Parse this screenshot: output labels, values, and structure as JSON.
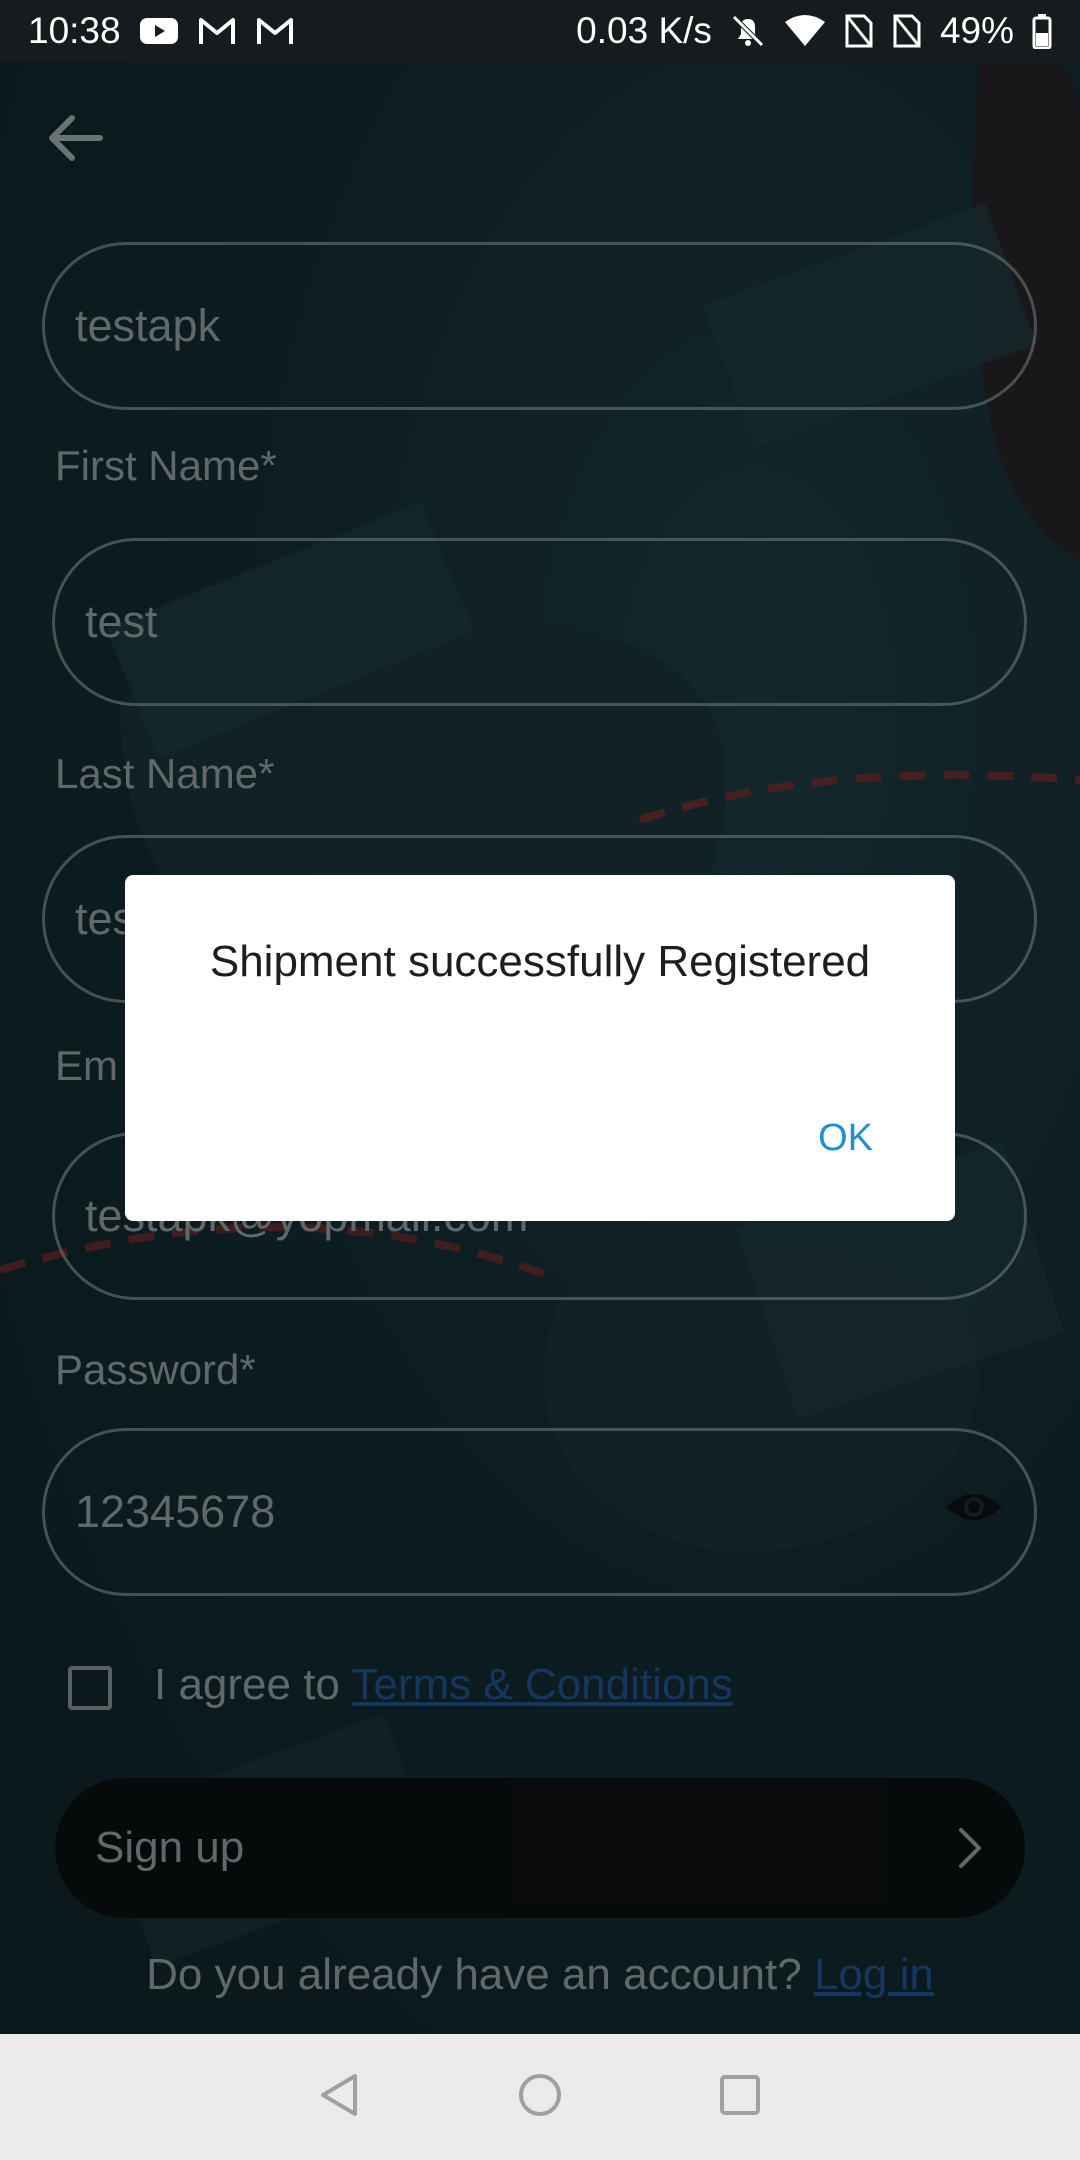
{
  "status_bar": {
    "time": "10:38",
    "net_speed": "0.03 K/s",
    "battery": "49%",
    "icons": [
      "youtube-icon",
      "gmail-icon",
      "gmail-icon",
      "bell-muted-icon",
      "wifi-icon",
      "no-sim-icon",
      "no-sim-icon",
      "battery-icon"
    ]
  },
  "form": {
    "username_value": "testapk",
    "first_name_label": "First Name*",
    "first_name_value": "test",
    "last_name_label": "Last Name*",
    "last_name_value": "tes",
    "email_label": "Em",
    "email_value": "testapk@yopmail.com",
    "password_label": "Password*",
    "password_value": "12345678",
    "agree_text": "I agree to",
    "terms_link": "Terms & Conditions",
    "signup_label": "Sign up",
    "login_prompt": "Do you already have an account?",
    "login_link": "Log in"
  },
  "dialog": {
    "message": "Shipment successfully Registered",
    "ok_label": "OK"
  },
  "colors": {
    "accent": "#1f8fd8",
    "link": "#1f4f86",
    "background": "#132a30"
  }
}
